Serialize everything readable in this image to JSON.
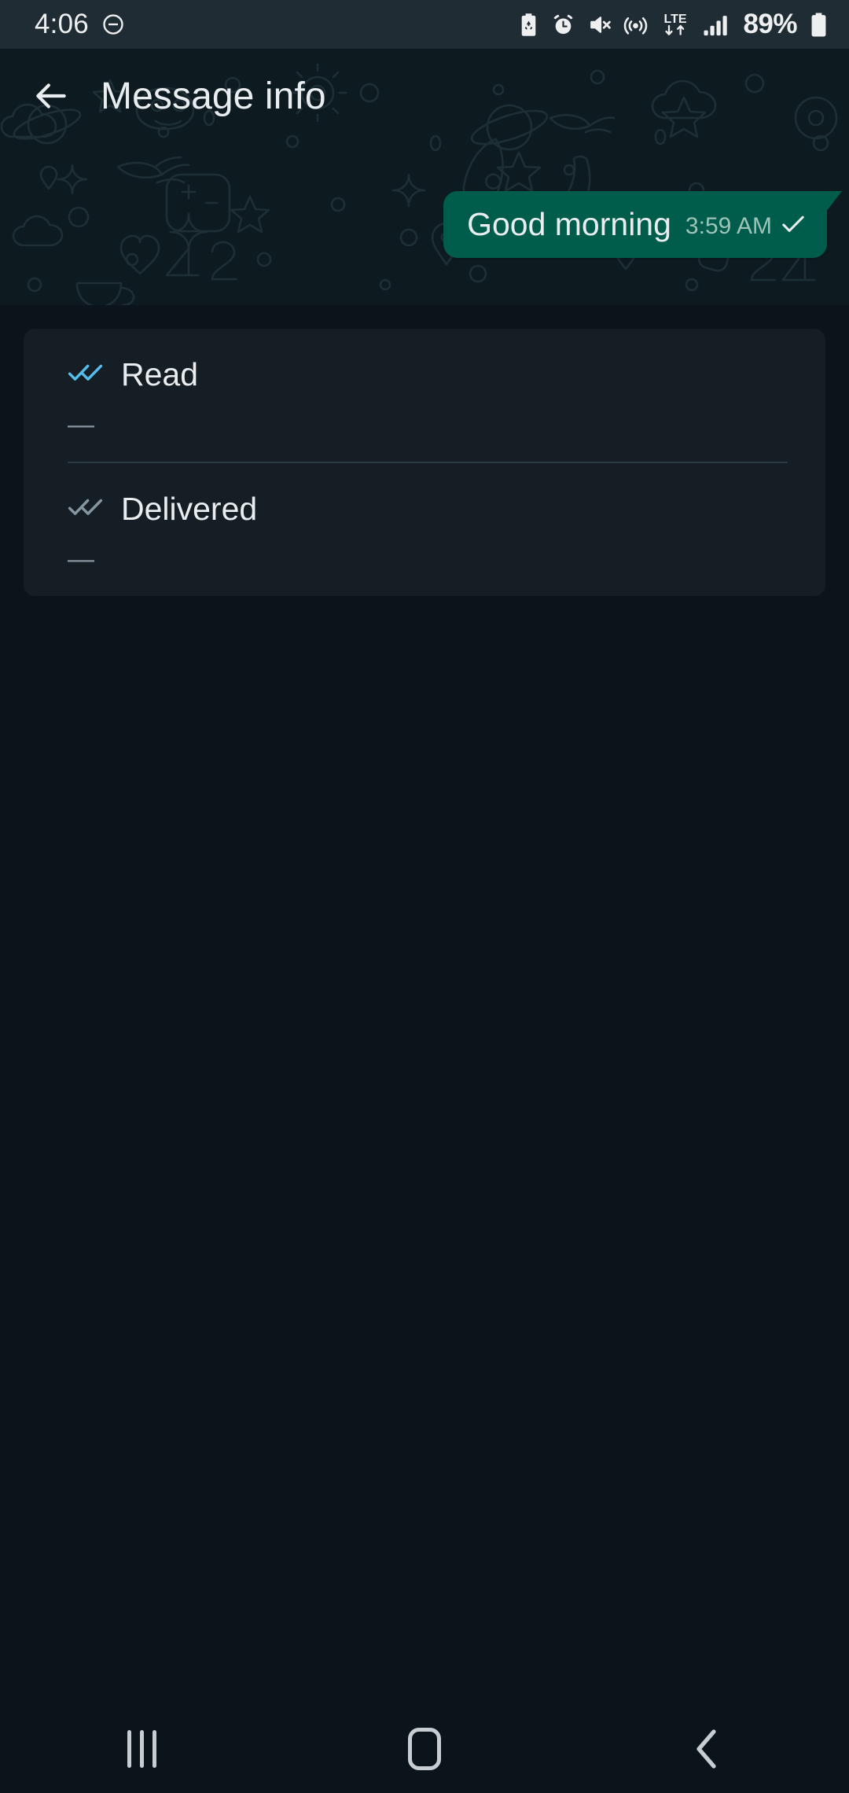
{
  "status_bar": {
    "time": "4:06",
    "battery_percent": "89%",
    "icons": [
      "do-not-disturb-icon",
      "battery-saver-icon",
      "alarm-icon",
      "mute-icon",
      "hotspot-icon",
      "lte-data-icon",
      "signal-bars-icon",
      "battery-icon"
    ],
    "network_label": "LTE"
  },
  "app_bar": {
    "back_label": "back-arrow",
    "title": "Message info"
  },
  "message": {
    "text": "Good morning",
    "time": "3:59 AM",
    "status_tick": "single-check",
    "bubble_color": "#005C4B"
  },
  "info_card": {
    "rows": [
      {
        "label": "Read",
        "value": "—",
        "tick": "double-check",
        "tick_color": "#53BDEB"
      },
      {
        "label": "Delivered",
        "value": "—",
        "tick": "double-check",
        "tick_color": "#8696A0"
      }
    ]
  },
  "nav_bar": {
    "recents_label": "recent-apps",
    "home_label": "home",
    "back_label": "back"
  },
  "theme": {
    "background": "#0B141A",
    "status_bar_bg": "#1F2C34",
    "wallpaper_bg": "#0D1B21",
    "card_bg": "#151E25",
    "divider": "#2A3942",
    "text_primary": "#E9EDEF",
    "text_secondary": "#8696A0",
    "accent_blue": "#53BDEB"
  }
}
